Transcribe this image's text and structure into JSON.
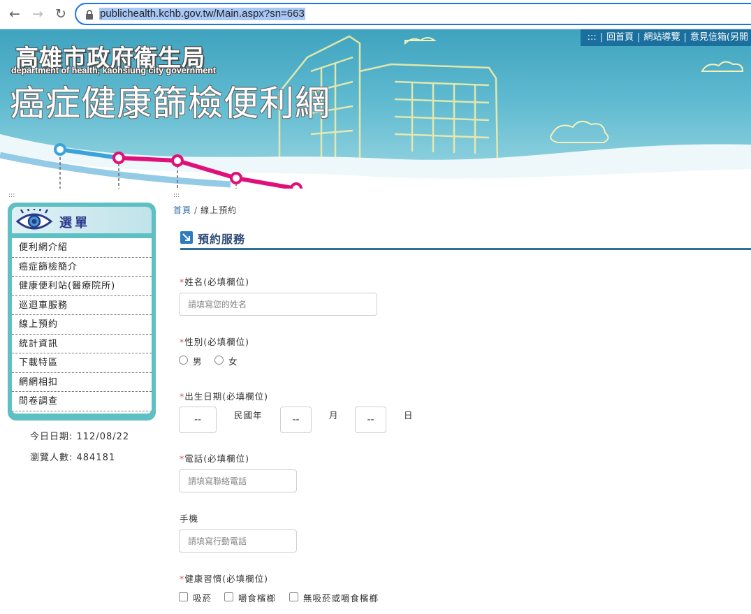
{
  "browser": {
    "back_icon": "arrow-left-icon",
    "forward_icon": "arrow-right-icon",
    "reload_icon": "reload-icon",
    "url": "publichealth.kchb.gov.tw/Main.aspx?sn=663"
  },
  "header": {
    "org_name": "高雄市政府衛生局",
    "org_name_en": "department of health, kaohsiung city government",
    "site_title": "癌症健康篩檢便利網",
    "top_links_prefix": ":::",
    "top_links": [
      "回首頁",
      "網站導覽",
      "意見信箱(另開"
    ]
  },
  "accessibility_marks": {
    "left": ":::",
    "main": ":::"
  },
  "sidebar": {
    "menu_title": "選單",
    "items": [
      "便利網介紹",
      "癌症篩檢簡介",
      "健康便利站(醫療院所)",
      "巡迴車服務",
      "線上預約",
      "統計資訊",
      "下載特區",
      "網網相扣",
      "問卷調查"
    ],
    "date_label": "今日日期: 112/08/22",
    "visitors_label": "瀏覽人數: 484181"
  },
  "breadcrumb": {
    "home": "首頁",
    "separator": "/",
    "current": "線上預約"
  },
  "section": {
    "title": "預約服務"
  },
  "form": {
    "required_mark": "*",
    "name": {
      "label": "姓名(必填欄位)",
      "placeholder": "請填寫您的姓名"
    },
    "gender": {
      "label": "性別(必填欄位)",
      "options": [
        "男",
        "女"
      ]
    },
    "birthday": {
      "label": "出生日期(必填欄位)",
      "year_value": "--",
      "year_label": "民國年",
      "month_value": "--",
      "month_label": "月",
      "day_value": "--",
      "day_label": "日"
    },
    "phone": {
      "label": "電話(必填欄位)",
      "placeholder": "請填寫聯絡電話"
    },
    "mobile": {
      "label": "手機",
      "placeholder": "請填寫行動電話"
    },
    "habits": {
      "label": "健康習慣(必填欄位)",
      "options": [
        "吸菸",
        "嚼食檳榔",
        "無吸菸或嚼食檳榔"
      ]
    }
  },
  "colors": {
    "accent": "#1a73e8",
    "sidebar": "#5fc0c3",
    "section_rule": "#2f6e99",
    "required": "#d9534f",
    "top_links_bg": "#1b6f9e"
  }
}
